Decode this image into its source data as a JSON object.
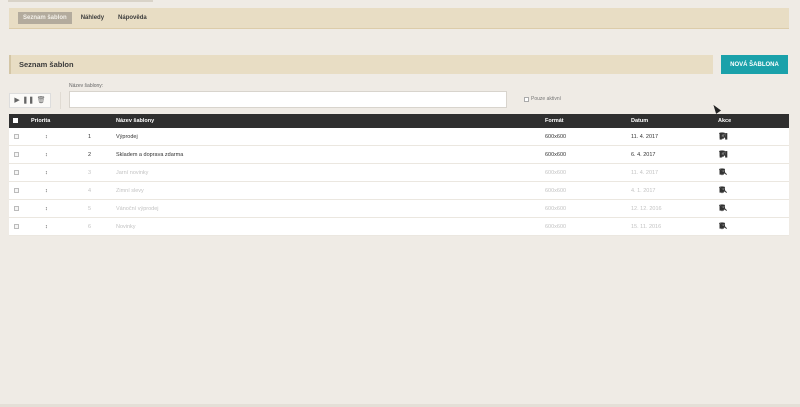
{
  "tabs": [
    {
      "label": "Seznam šablon",
      "active": true
    },
    {
      "label": "Náhledy",
      "active": false
    },
    {
      "label": "Nápověda",
      "active": false
    }
  ],
  "section": {
    "title": "Seznam šablon"
  },
  "new_button": "NOVÁ ŠABLONA",
  "filter": {
    "label": "Název šablony:",
    "value": "",
    "active_only_label": "Pouze aktivní"
  },
  "table": {
    "headers": {
      "priority": "Priorita",
      "name": "Název šablony",
      "format": "Formát",
      "date": "Datum",
      "actions": "Akce"
    },
    "rows": [
      {
        "num": "1",
        "name": "Výprodej",
        "format": "600x600",
        "date": "11. 4. 2017",
        "active": true
      },
      {
        "num": "2",
        "name": "Skladem a doprava zdarma",
        "format": "600x600",
        "date": "6. 4. 2017",
        "active": true
      },
      {
        "num": "3",
        "name": "Jarní novinky",
        "format": "600x600",
        "date": "11. 4. 2017",
        "active": false
      },
      {
        "num": "4",
        "name": "Zimní slevy",
        "format": "600x600",
        "date": "4. 1. 2017",
        "active": false
      },
      {
        "num": "5",
        "name": "Vánoční výprodej",
        "format": "600x600",
        "date": "12. 12. 2016",
        "active": false
      },
      {
        "num": "6",
        "name": "Novinky",
        "format": "600x600",
        "date": "15. 11. 2016",
        "active": false
      }
    ]
  },
  "colors": {
    "accent": "#1aa1aa",
    "header_bg": "#e8ddc4",
    "table_header": "#2f2f2f"
  }
}
